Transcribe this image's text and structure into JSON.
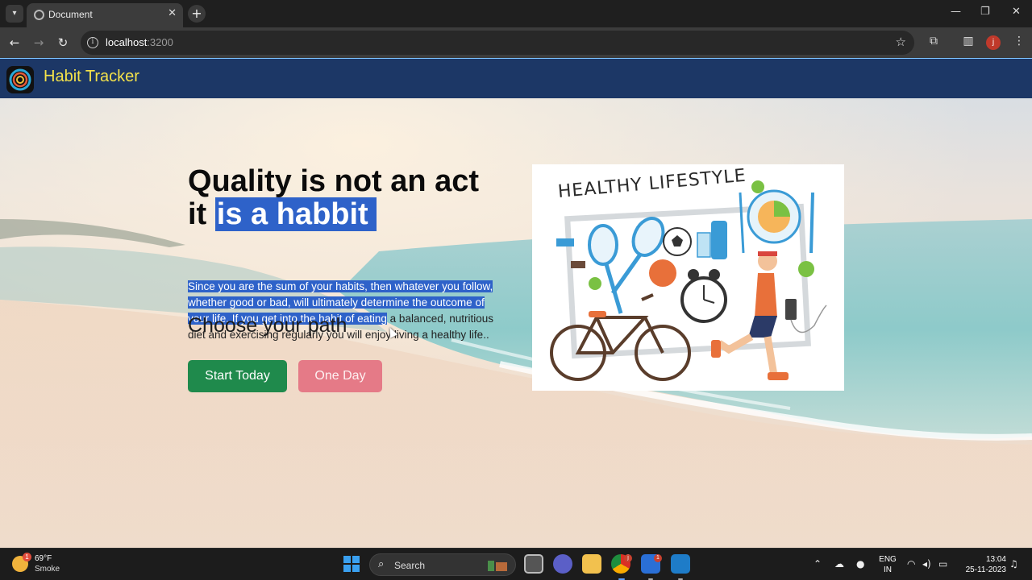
{
  "browser": {
    "tab_title": "Document",
    "url_host": "localhost",
    "url_port": ":3200",
    "profile_initial": "j"
  },
  "navbar": {
    "brand": "Habit Tracker"
  },
  "hero": {
    "headline_line1": "Quality is not an act",
    "headline_line2_prefix": "it ",
    "headline_line2_highlight": "is a habbit",
    "description_selected": "Since you are the sum of your habits, then whatever you follow, whether good or bad, will ultimately determine the outcome of your life. If you get into the habit of eating",
    "description_rest": " a balanced, nutritious diet and exercising regularly you will enjoy living a healthy life..",
    "choose_heading": "Choose your path",
    "start_button": "Start Today",
    "later_button": "One Day",
    "illustration_title": "HEALTHY LIFESTYLE"
  },
  "taskbar": {
    "weather_temp": "69°F",
    "weather_condition": "Smoke",
    "weather_badge": "1",
    "search_label": "Search",
    "chrome_badge": "j",
    "camera_badge": "1",
    "lang_line1": "ENG",
    "lang_line2": "IN",
    "time": "13:04",
    "date": "25-11-2023"
  },
  "colors": {
    "navbar_bg": "#1c3766",
    "brand_text": "#f4e24a",
    "start_button": "#1f8a4c",
    "later_button": "#e57a87",
    "selection": "#2e62c9"
  }
}
